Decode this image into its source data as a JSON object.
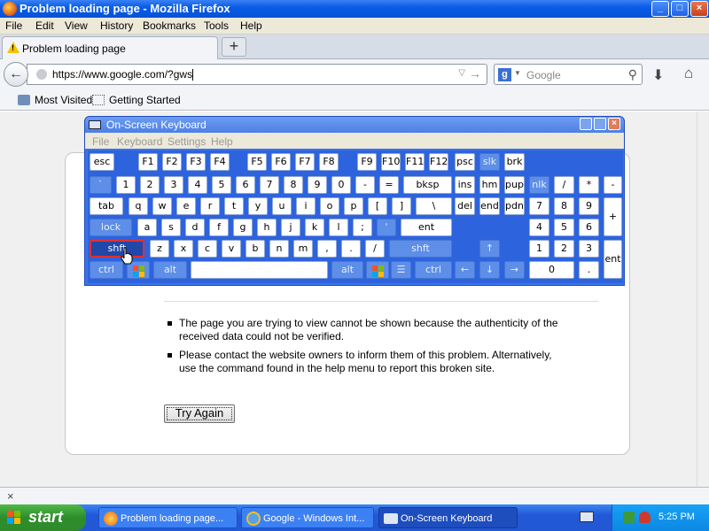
{
  "window": {
    "title": "Problem loading page - Mozilla Firefox",
    "controls": {
      "minimize": "_",
      "maximize": "□",
      "close": "×"
    }
  },
  "menu": [
    "File",
    "Edit",
    "View",
    "History",
    "Bookmarks",
    "Tools",
    "Help"
  ],
  "tabs": [
    {
      "label": "Problem loading page"
    }
  ],
  "newtab_label": "+",
  "nav": {
    "url": "https://www.google.com/?gws",
    "search_placeholder": "Google",
    "search_engine_letter": "g"
  },
  "bookmarks": [
    "Most Visited",
    "Getting Started"
  ],
  "error": {
    "bullets": [
      "The page you are trying to view cannot be shown because the authenticity of the received data could not be verified.",
      "Please contact the website owners to inform them of this problem. Alternatively, use the command found in the help menu to report this broken site."
    ],
    "try_again": "Try Again"
  },
  "status": {
    "close_glyph": "×"
  },
  "osk": {
    "title": "On-Screen Keyboard",
    "close_glyph": "×",
    "menu": [
      "File",
      "Keyboard",
      "Settings",
      "Help"
    ],
    "keys": [
      {
        "id": "esc",
        "label": "esc"
      },
      {
        "id": "f1",
        "label": "F1"
      },
      {
        "id": "f2",
        "label": "F2"
      },
      {
        "id": "f3",
        "label": "F3"
      },
      {
        "id": "f4",
        "label": "F4"
      },
      {
        "id": "f5",
        "label": "F5"
      },
      {
        "id": "f6",
        "label": "F6"
      },
      {
        "id": "f7",
        "label": "F7"
      },
      {
        "id": "f8",
        "label": "F8"
      },
      {
        "id": "f9",
        "label": "F9"
      },
      {
        "id": "f10",
        "label": "F10"
      },
      {
        "id": "f11",
        "label": "F11"
      },
      {
        "id": "f12",
        "label": "F12"
      },
      {
        "id": "psc",
        "label": "psc"
      },
      {
        "id": "slk",
        "label": "slk"
      },
      {
        "id": "brk",
        "label": "brk"
      },
      {
        "id": "backtick",
        "label": "`"
      },
      {
        "id": "1",
        "label": "1"
      },
      {
        "id": "2",
        "label": "2"
      },
      {
        "id": "3",
        "label": "3"
      },
      {
        "id": "4",
        "label": "4"
      },
      {
        "id": "5",
        "label": "5"
      },
      {
        "id": "6",
        "label": "6"
      },
      {
        "id": "7",
        "label": "7"
      },
      {
        "id": "8",
        "label": "8"
      },
      {
        "id": "9",
        "label": "9"
      },
      {
        "id": "0",
        "label": "0"
      },
      {
        "id": "minus",
        "label": "-"
      },
      {
        "id": "equals",
        "label": "="
      },
      {
        "id": "bksp",
        "label": "bksp"
      },
      {
        "id": "ins",
        "label": "ins"
      },
      {
        "id": "hm",
        "label": "hm"
      },
      {
        "id": "pup",
        "label": "pup"
      },
      {
        "id": "nlk",
        "label": "nlk"
      },
      {
        "id": "np-slash",
        "label": "/"
      },
      {
        "id": "np-star",
        "label": "*"
      },
      {
        "id": "np-minus",
        "label": "-"
      },
      {
        "id": "tab",
        "label": "tab"
      },
      {
        "id": "q",
        "label": "q"
      },
      {
        "id": "w",
        "label": "w"
      },
      {
        "id": "e",
        "label": "e"
      },
      {
        "id": "r",
        "label": "r"
      },
      {
        "id": "t",
        "label": "t"
      },
      {
        "id": "y",
        "label": "y"
      },
      {
        "id": "u",
        "label": "u"
      },
      {
        "id": "i",
        "label": "i"
      },
      {
        "id": "o",
        "label": "o"
      },
      {
        "id": "p",
        "label": "p"
      },
      {
        "id": "lbracket",
        "label": "["
      },
      {
        "id": "rbracket",
        "label": "]"
      },
      {
        "id": "backslash",
        "label": "\\"
      },
      {
        "id": "del",
        "label": "del"
      },
      {
        "id": "end",
        "label": "end"
      },
      {
        "id": "pdn",
        "label": "pdn"
      },
      {
        "id": "np7",
        "label": "7"
      },
      {
        "id": "np8",
        "label": "8"
      },
      {
        "id": "np9",
        "label": "9"
      },
      {
        "id": "np-plus",
        "label": "+"
      },
      {
        "id": "lock",
        "label": "lock"
      },
      {
        "id": "a",
        "label": "a"
      },
      {
        "id": "s",
        "label": "s"
      },
      {
        "id": "d",
        "label": "d"
      },
      {
        "id": "f",
        "label": "f"
      },
      {
        "id": "g",
        "label": "g"
      },
      {
        "id": "h",
        "label": "h"
      },
      {
        "id": "j",
        "label": "j"
      },
      {
        "id": "k",
        "label": "k"
      },
      {
        "id": "l",
        "label": "l"
      },
      {
        "id": "semicolon",
        "label": ";"
      },
      {
        "id": "quote",
        "label": "'"
      },
      {
        "id": "ent",
        "label": "ent"
      },
      {
        "id": "np4",
        "label": "4"
      },
      {
        "id": "np5",
        "label": "5"
      },
      {
        "id": "np6",
        "label": "6"
      },
      {
        "id": "lshft",
        "label": "shft"
      },
      {
        "id": "z",
        "label": "z"
      },
      {
        "id": "x",
        "label": "x"
      },
      {
        "id": "c",
        "label": "c"
      },
      {
        "id": "v",
        "label": "v"
      },
      {
        "id": "b",
        "label": "b"
      },
      {
        "id": "n",
        "label": "n"
      },
      {
        "id": "m",
        "label": "m"
      },
      {
        "id": "comma",
        "label": ","
      },
      {
        "id": "period",
        "label": "."
      },
      {
        "id": "slash",
        "label": "/"
      },
      {
        "id": "rshft",
        "label": "shft"
      },
      {
        "id": "up",
        "label": "↑"
      },
      {
        "id": "np1",
        "label": "1"
      },
      {
        "id": "np2",
        "label": "2"
      },
      {
        "id": "np3",
        "label": "3"
      },
      {
        "id": "np-ent",
        "label": "ent"
      },
      {
        "id": "lctrl",
        "label": "ctrl"
      },
      {
        "id": "lalt",
        "label": "alt"
      },
      {
        "id": "space",
        "label": ""
      },
      {
        "id": "ralt",
        "label": "alt"
      },
      {
        "id": "rctrl",
        "label": "ctrl"
      },
      {
        "id": "left",
        "label": "←"
      },
      {
        "id": "down",
        "label": "↓"
      },
      {
        "id": "right",
        "label": "→"
      },
      {
        "id": "np0",
        "label": "0"
      },
      {
        "id": "np-dot",
        "label": "."
      }
    ]
  },
  "taskbar": {
    "start": "start",
    "tasks": [
      "Problem loading page...",
      "Google - Windows Int...",
      "On-Screen Keyboard"
    ],
    "clock": "5:25 PM"
  }
}
